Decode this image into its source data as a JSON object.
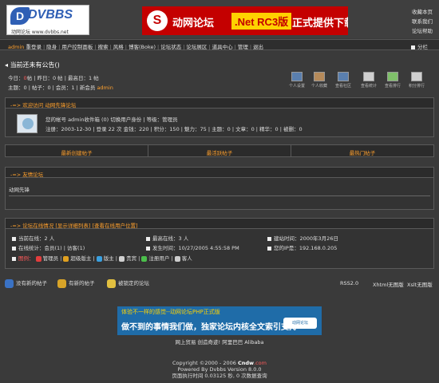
{
  "header": {
    "logo_text": "DVBBS",
    "logo_subtitle": "动网论坛 www.dvbbs.net",
    "banner": {
      "text1": "动网论坛",
      "net_badge": ".Net RC3版",
      "text2": "正式提供下载"
    },
    "top_links": [
      "收藏本页",
      "联系我们",
      "论坛帮助"
    ]
  },
  "nav": {
    "user": "admin",
    "items": [
      "重登录",
      "隐身",
      "用户控制面板",
      "搜索",
      "风格",
      "博客(Boke)",
      "论坛状态",
      "论坛展区",
      "道具中心",
      "管理",
      "退出"
    ],
    "toggle_label": "分栏"
  },
  "notice": "当前还未有公告()",
  "stats": {
    "line1_a": "今日：",
    "line1_today": "0",
    "line1_b": "帖 | 昨日：0 帖 | 最高日：1 帖",
    "line2_a": "主题：0 | 帖子：0 | 会员：1 | 新会员",
    "line2_newmember": "admin"
  },
  "quick_icons": [
    "个人设置",
    "个人收藏",
    "查看社区",
    "查看统计",
    "查看排行",
    "积分排行"
  ],
  "welcome": {
    "title": "-=> 欢迎访问 动网先锋论坛",
    "line1": "您的帐号 admin收件箱 (0) 切换用户身份 | 等级：管理员",
    "line2": "注册：2003-12-30 | 登录 22 次 金钱：220 | 积分：150 | 魅力：75 | 主题：0 | 文章：0 | 精华：0 | 被删：0"
  },
  "tabs": [
    "最新创建帖子",
    "最活跃帖子",
    "最热门帖子"
  ],
  "friends": {
    "title": "-=> 友情论坛",
    "body": "动网先锋"
  },
  "online": {
    "title": "-=> 论坛在线情况 [显示详细列表] [查看在线用户位置]",
    "current_online": "当前在线：2 人",
    "max_online": "最高在线：3 人",
    "founded": "建站时间：2000年3月26日",
    "online_detail": "在线统计：会员(1) | 访客(1)",
    "occurred": "发生时间：10/27/2005 4:55:58 PM",
    "your_ip": "您的IP是：192.168.0.205",
    "legend_title": "图例：",
    "legend": [
      "管理员",
      "超级版主",
      "版主",
      "贵宾",
      "注册用户",
      "客人"
    ],
    "legend_colors": [
      "#e23d3d",
      "#e0a020",
      "#3aa0e0",
      "#d0d0d0",
      "#4bbf4b",
      "#cccccc"
    ]
  },
  "bottom_legend": {
    "items": [
      "没有新的帖子",
      "有新的帖子",
      "被锁定的论坛"
    ],
    "colors": [
      "#3a72c4",
      "#d8a428",
      "#e2c040"
    ],
    "feeds": [
      "RSS2.0",
      "Xhtml无图版",
      "Xslt无图版"
    ]
  },
  "footer": {
    "ad_top": "体验不一样的感觉--动网论坛PHP正式版",
    "ad_main": "做不到的事情我们做，独家论坛内核全文索引支持",
    "ad_logo": "动网论坛",
    "ad2": "网上贸易 创造奇迹! 阿里巴巴 Alibaba",
    "copyright": "Copyright ©2000 - 2006",
    "copyright_brand": "Cndw",
    "copyright_suffix": ".com",
    "powered": "Powered By Dvbbs Version 8.0.0",
    "exec": "页面执行时间 0.03125 秒, 0 次数据查询"
  }
}
